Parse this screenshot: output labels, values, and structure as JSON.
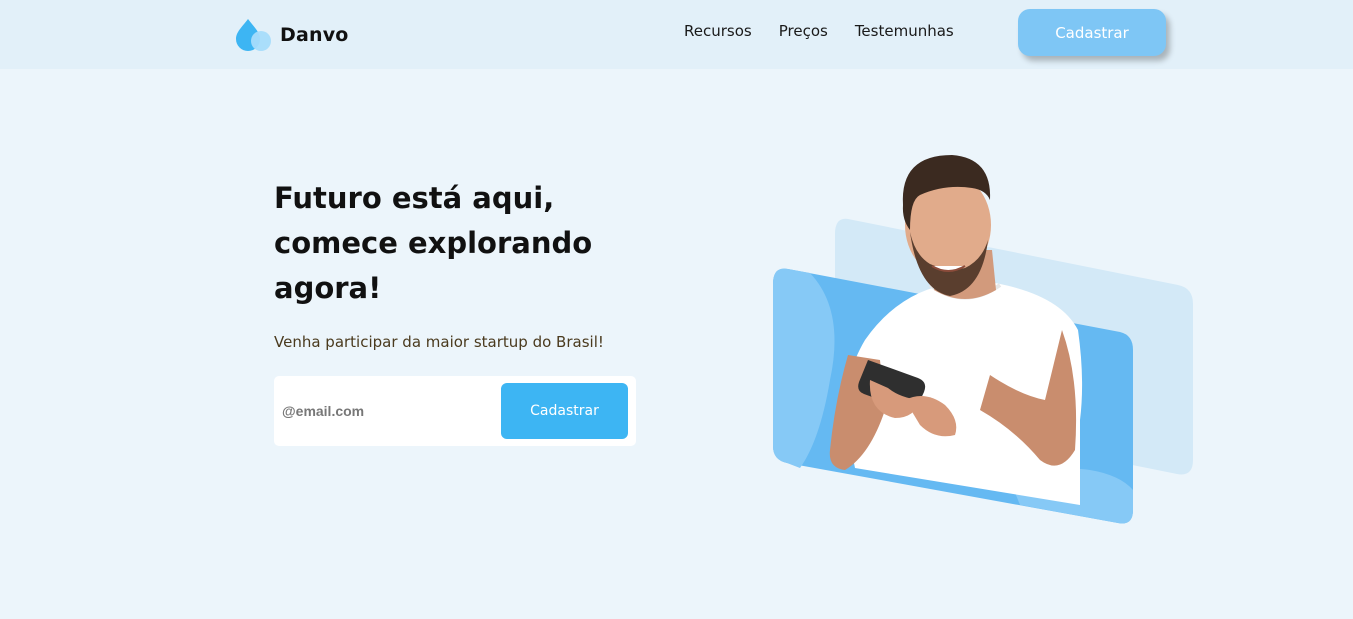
{
  "header": {
    "brand": "Danvo",
    "logo_icon": "water-drop-icon",
    "nav": [
      {
        "label": "Recursos"
      },
      {
        "label": "Preços"
      },
      {
        "label": "Testemunhas"
      }
    ],
    "cta_label": "Cadastrar"
  },
  "hero": {
    "title_lines": [
      "Futuro está aqui,",
      "comece explorando",
      "agora!"
    ],
    "subtitle": "Venha participar da maior startup do Brasil!",
    "form": {
      "email_placeholder": "@email.com",
      "submit_label": "Cadastrar"
    },
    "image_alt": "man-smiling-holding-phone"
  },
  "colors": {
    "background": "#ecf5fb",
    "header_bg": "#e2f0f9",
    "accent": "#3db5f3",
    "accent_light": "#7ec6f5"
  }
}
